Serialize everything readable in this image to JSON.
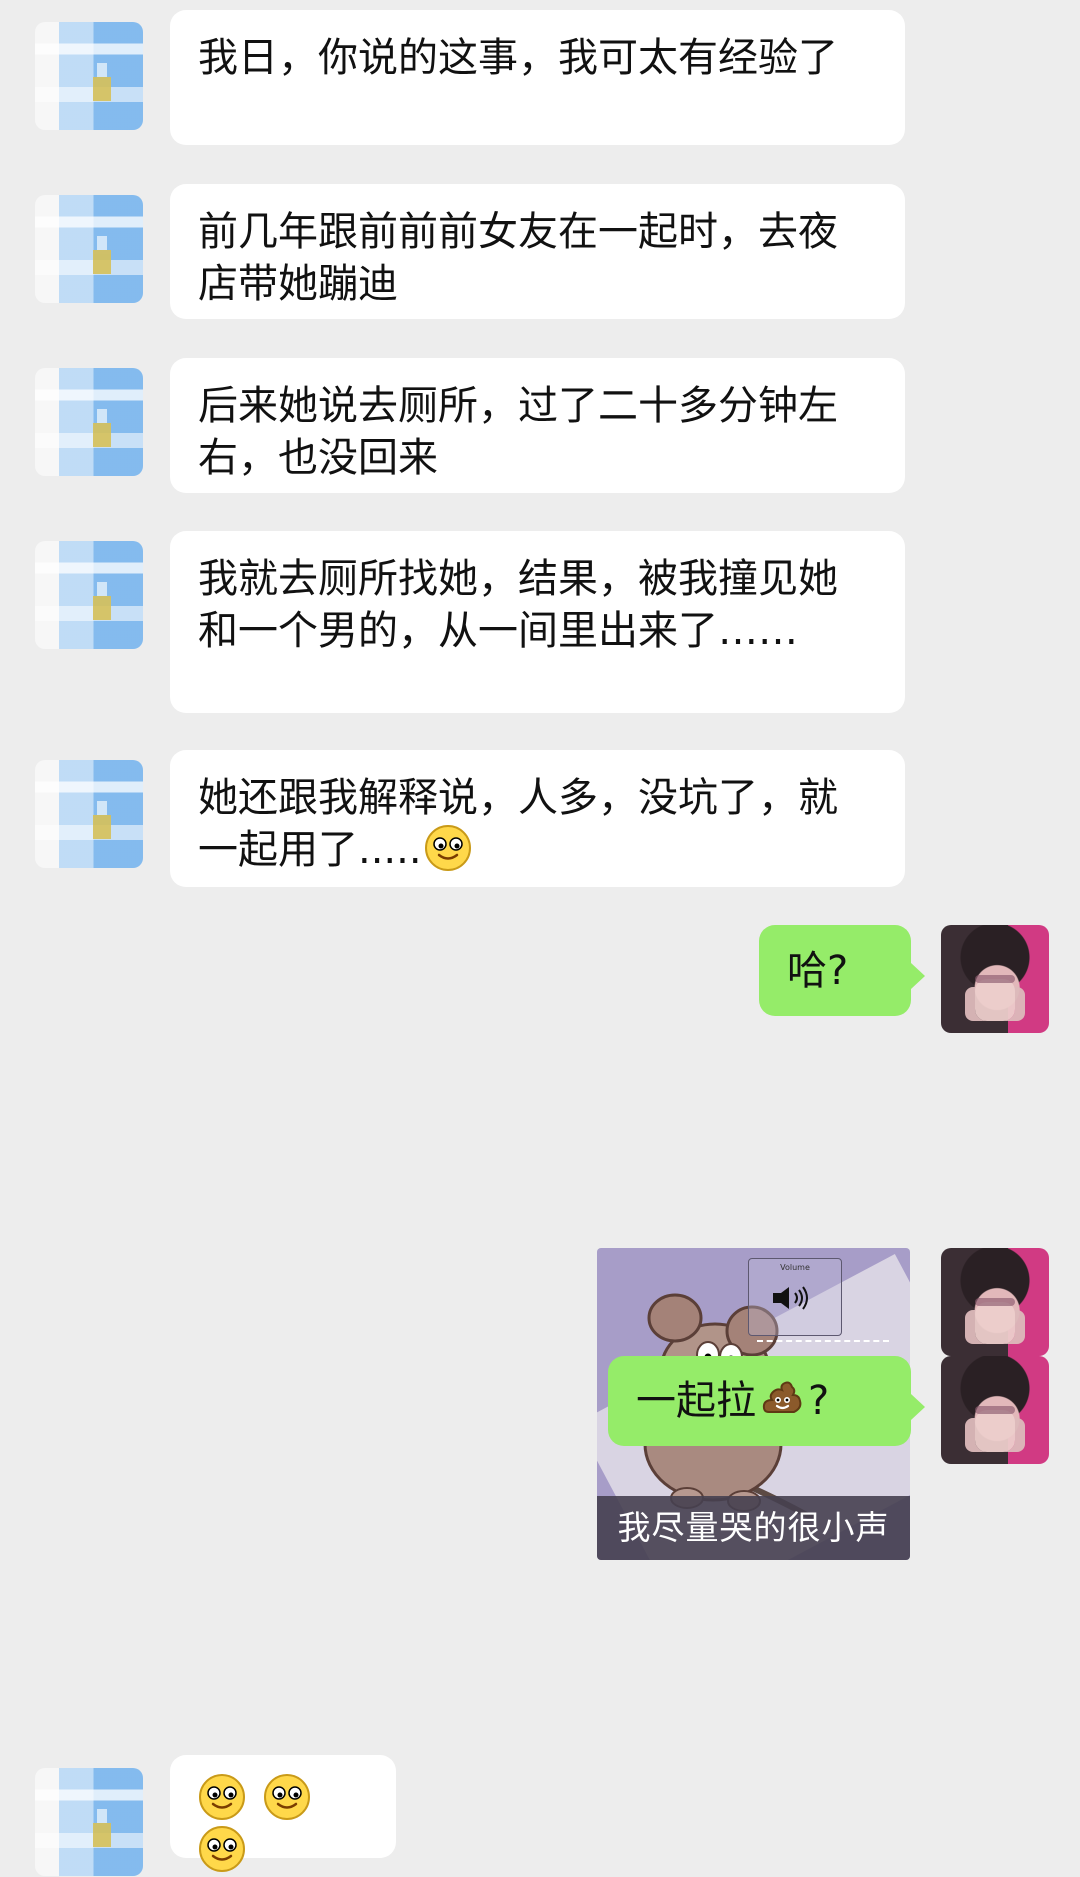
{
  "conversation": {
    "messages": [
      {
        "sender": "friend",
        "text": "我日，你说的这事，我可太有经验了"
      },
      {
        "sender": "friend",
        "text": "前几年跟前前前女友在一起时，去夜店带她蹦迪"
      },
      {
        "sender": "friend",
        "text": "后来她说去厕所，过了二十多分钟左右，也没回来"
      },
      {
        "sender": "friend",
        "text": "我就去厕所找她，结果，被我撞见她和一个男的，从一间里出来了……"
      },
      {
        "sender": "friend",
        "text": "她还跟我解释说，人多，没坑了，就一起用了.....",
        "emoji": "slightly-smiling-face"
      },
      {
        "sender": "self",
        "text": "哈?"
      },
      {
        "sender": "self",
        "type": "sticker",
        "caption": "我尽量哭的很小声",
        "volume_label": "Volume"
      },
      {
        "sender": "self",
        "text": "一起拉",
        "emoji": "pile-of-poo",
        "suffix": "?"
      },
      {
        "sender": "friend",
        "emoji_count": 3,
        "emoji": "slightly-smiling-face"
      }
    ]
  },
  "colors": {
    "background": "#ededed",
    "friend_bubble": "#ffffff",
    "self_bubble": "#95ec69"
  },
  "icons": {
    "friend_avatar": "blurred-avatar",
    "self_avatar": "photo-avatar",
    "smile": "slightly-smiling-face",
    "poop": "pile-of-poo"
  }
}
